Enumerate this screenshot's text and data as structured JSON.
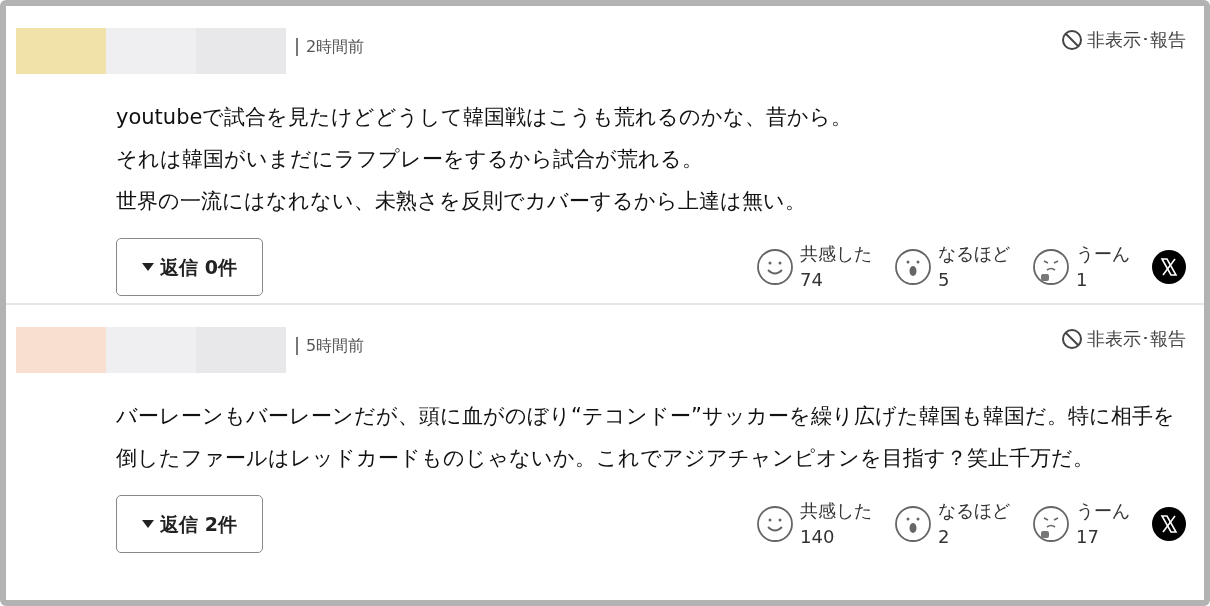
{
  "comments": [
    {
      "color": "#f0e2a8",
      "time": "2時間前",
      "hide_report": "非表示･報告",
      "paragraphs": [
        "youtubeで試合を見たけどどうして韓国戦はこうも荒れるのかな、昔から。",
        "それは韓国がいまだにラフプレーをするから試合が荒れる。",
        "世界の一流にはなれない、未熟さを反則でカバーするから上達は無い。"
      ],
      "replies": "返信 0件",
      "reactions": [
        {
          "kind": "smile",
          "label": "共感した",
          "count": "74"
        },
        {
          "kind": "wow",
          "label": "なるほど",
          "count": "5"
        },
        {
          "kind": "hmm",
          "label": "うーん",
          "count": "1"
        }
      ]
    },
    {
      "color": "#f8dfcf",
      "time": "5時間前",
      "hide_report": "非表示･報告",
      "paragraphs": [
        "バーレーンもバーレーンだが、頭に血がのぼり“テコンドー”サッカーを繰り広げた韓国も韓国だ。特に相手を倒したファールはレッドカードものじゃないか。これでアジアチャンピオンを目指す？笑止千万だ。"
      ],
      "replies": "返信 2件",
      "reactions": [
        {
          "kind": "smile",
          "label": "共感した",
          "count": "140"
        },
        {
          "kind": "wow",
          "label": "なるほど",
          "count": "2"
        },
        {
          "kind": "hmm",
          "label": "うーん",
          "count": "17"
        }
      ]
    }
  ]
}
